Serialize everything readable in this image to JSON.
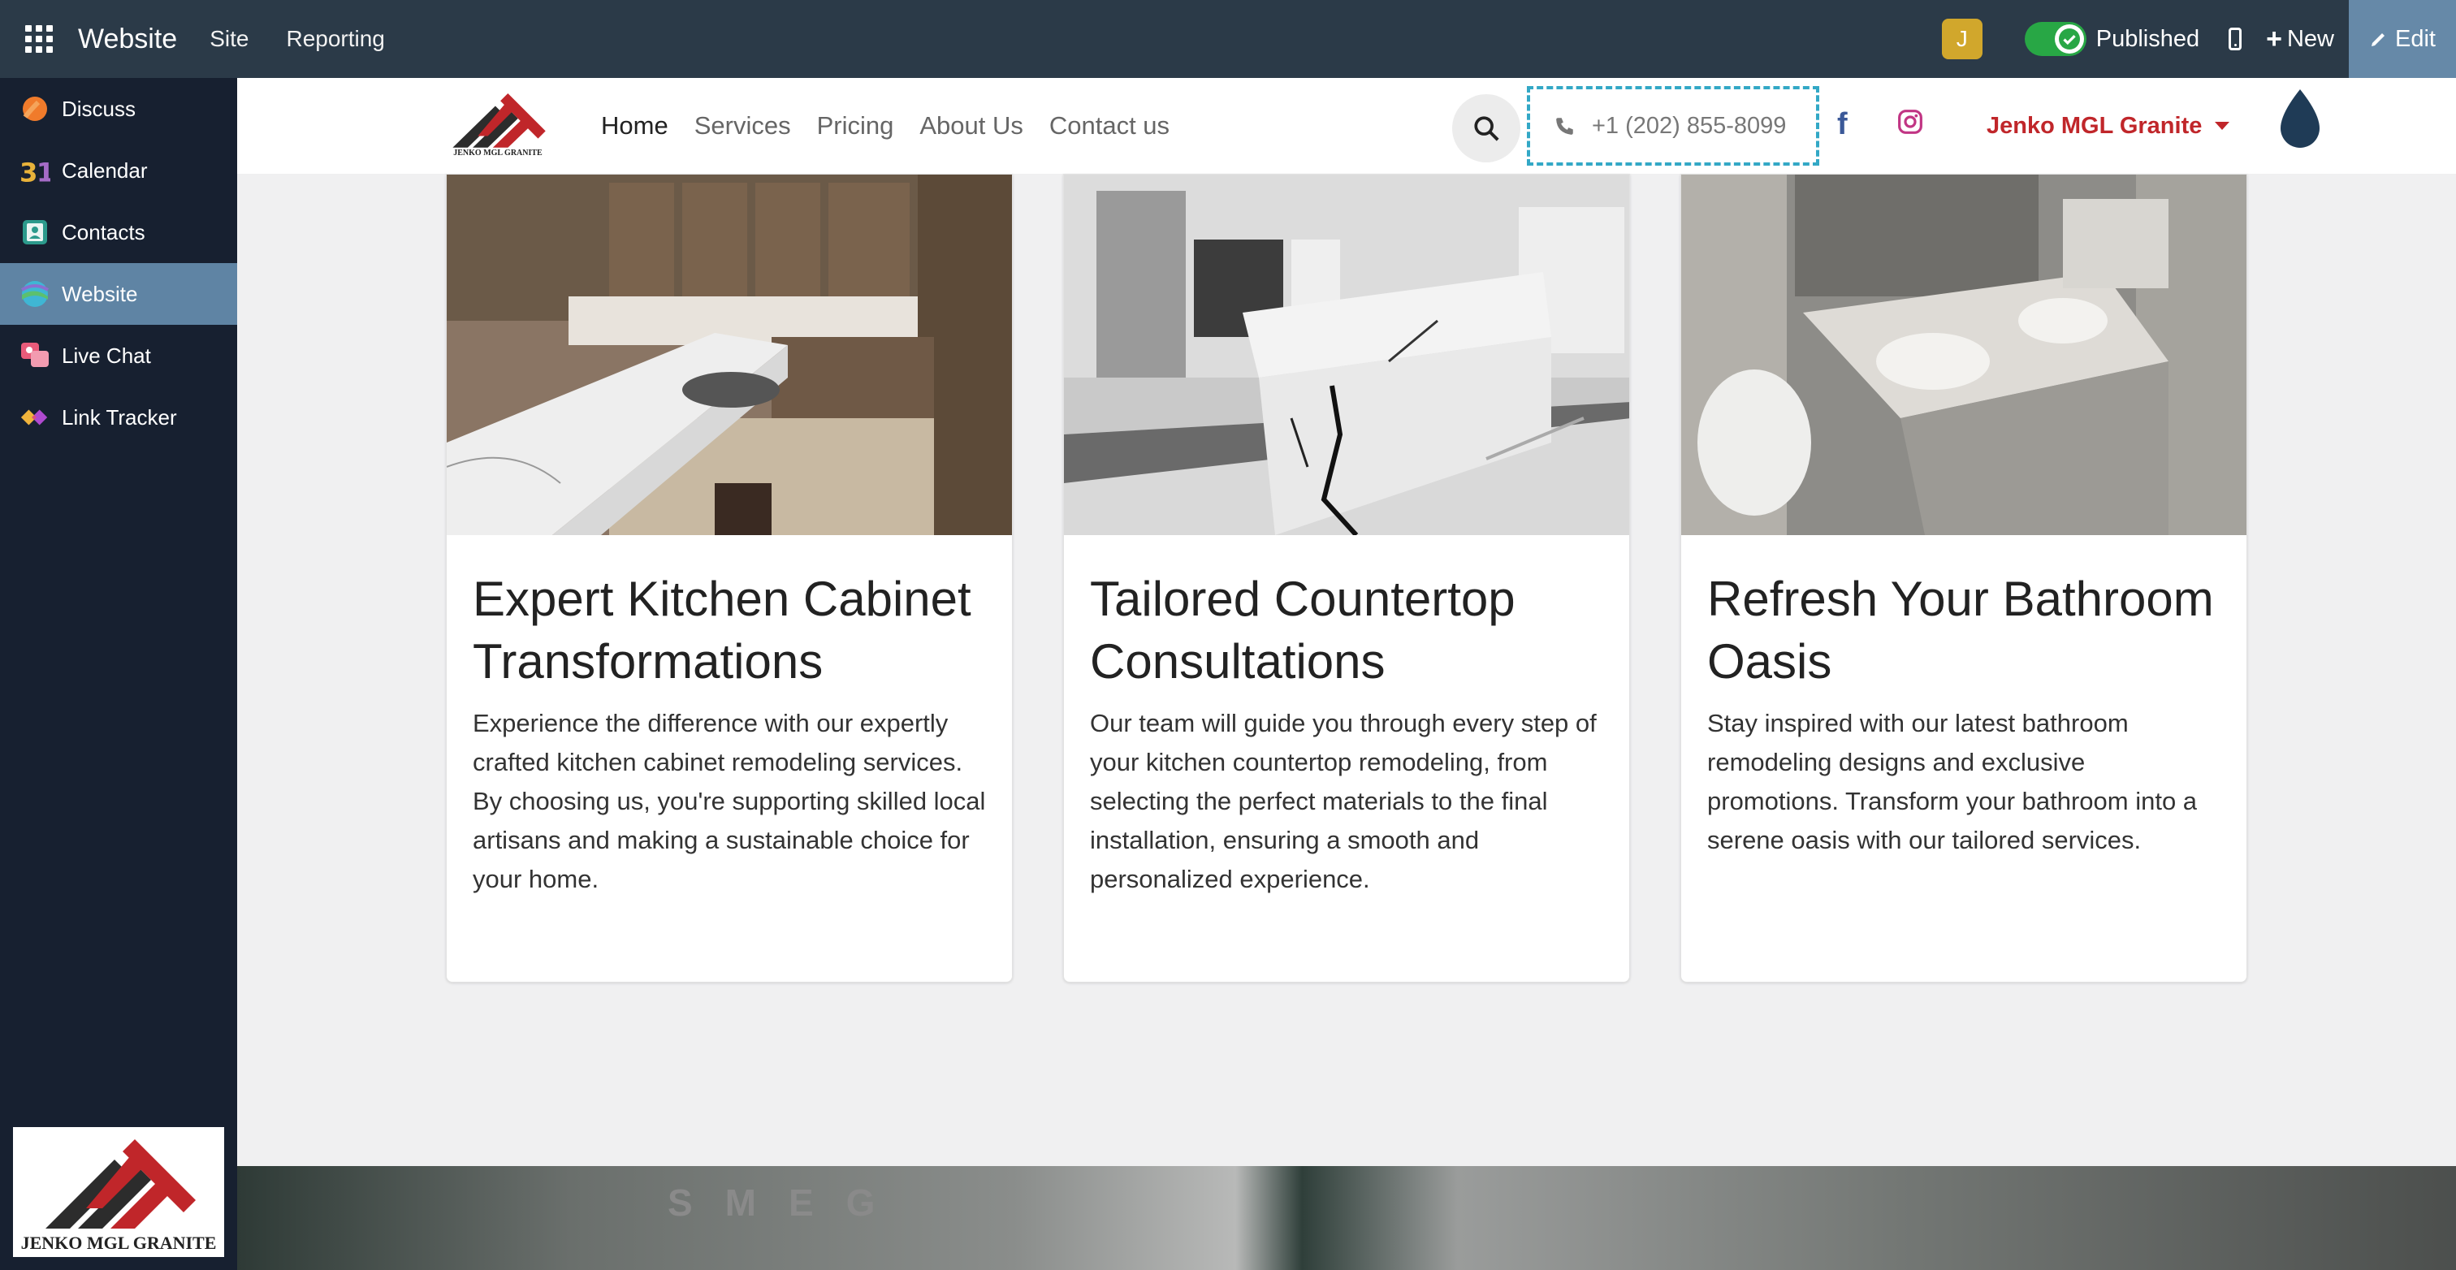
{
  "topbar": {
    "app_name": "Website",
    "menus": [
      "Site",
      "Reporting"
    ],
    "avatar_letter": "J",
    "published_label": "Published",
    "new_label": "New",
    "edit_label": "Edit"
  },
  "sidebar": {
    "items": [
      {
        "label": "Discuss",
        "icon": "discuss-icon",
        "active": false
      },
      {
        "label": "Calendar",
        "icon": "calendar-icon",
        "active": false
      },
      {
        "label": "Contacts",
        "icon": "contacts-icon",
        "active": false
      },
      {
        "label": "Website",
        "icon": "website-icon",
        "active": true
      },
      {
        "label": "Live Chat",
        "icon": "live-chat-icon",
        "active": false
      },
      {
        "label": "Link Tracker",
        "icon": "link-tracker-icon",
        "active": false
      }
    ],
    "logo_caption": "JENKO MGL GRANITE"
  },
  "site": {
    "logo_caption": "JENKO MGL GRANITE",
    "nav": [
      "Home",
      "Services",
      "Pricing",
      "About Us",
      "Contact us"
    ],
    "phone": "+1 (202) 855-8099",
    "company": "Jenko MGL Granite"
  },
  "cards": [
    {
      "title": "Expert Kitchen Cabinet Transformations",
      "text": "Experience the difference with our expertly crafted kitchen cabinet remodeling services. By choosing us, you're supporting skilled local artisans and making a sustainable choice for your home."
    },
    {
      "title": "Tailored Countertop Consultations",
      "text": "Our team will guide you through every step of your kitchen countertop remodeling, from selecting the perfect materials to the final installation, ensuring a smooth and personalized experience."
    },
    {
      "title": "Refresh Your Bathroom Oasis",
      "text": "Stay inspired with our latest bathroom remodeling designs and exclusive promotions. Transform your bathroom into a serene oasis with our tailored services."
    }
  ],
  "bottom": {
    "brand_text": "SMEG"
  },
  "colors": {
    "topbar": "#2b3a48",
    "sidebar": "#172030",
    "active": "#5f84a4",
    "brand_red": "#c0262a",
    "published_green": "#28a745"
  }
}
